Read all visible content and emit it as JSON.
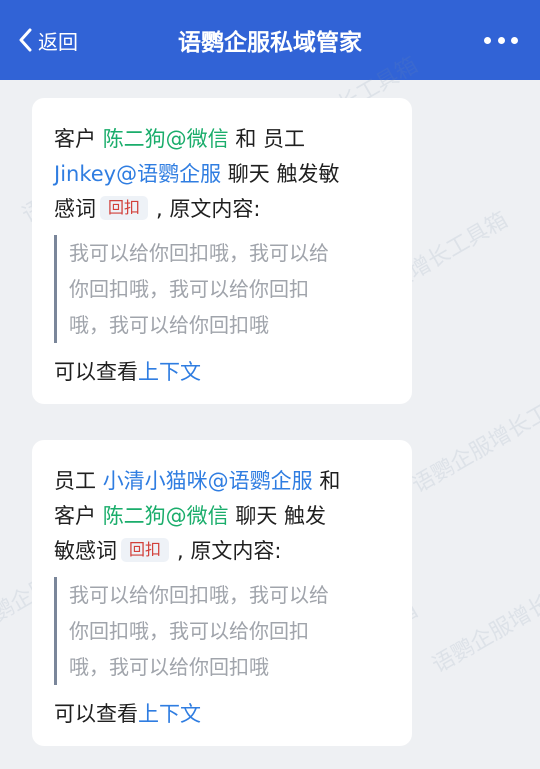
{
  "topbar": {
    "back_label": "返回",
    "title": "语鹦企服私域管家",
    "accent": "#3163d6"
  },
  "watermark_text": "语鹦企服增长工具箱",
  "cards": [
    {
      "lines": [
        [
          "客户 ",
          "陈二狗@微信",
          " 和 员工"
        ],
        [
          "Jinkey@语鹦企服",
          " 聊天 触发敏"
        ],
        [
          "感词",
          "回扣",
          ", 原文内容:"
        ]
      ],
      "quote_lines": [
        "我可以给你回扣哦，我可以给",
        "你回扣哦，我可以给你回扣",
        "哦，我可以给你回扣哦"
      ],
      "context_prefix": "可以查看",
      "context_link": "上下文"
    },
    {
      "lines": [
        [
          "员工 ",
          "小清小猫咪@语鹦企服",
          " 和"
        ],
        [
          "客户 ",
          "陈二狗@微信",
          " 聊天 触发"
        ],
        [
          "敏感词",
          "回扣",
          ", 原文内容:"
        ]
      ],
      "quote_lines": [
        "我可以给你回扣哦，我可以给",
        "你回扣哦，我可以给你回扣",
        "哦，我可以给你回扣哦"
      ],
      "context_prefix": "可以查看",
      "context_link": "上下文"
    }
  ],
  "colors": {
    "customer_name": "#1aad6b",
    "employee_name": "#2f7de1",
    "keyword_tag": "#d2403a",
    "link": "#2f7de1"
  }
}
